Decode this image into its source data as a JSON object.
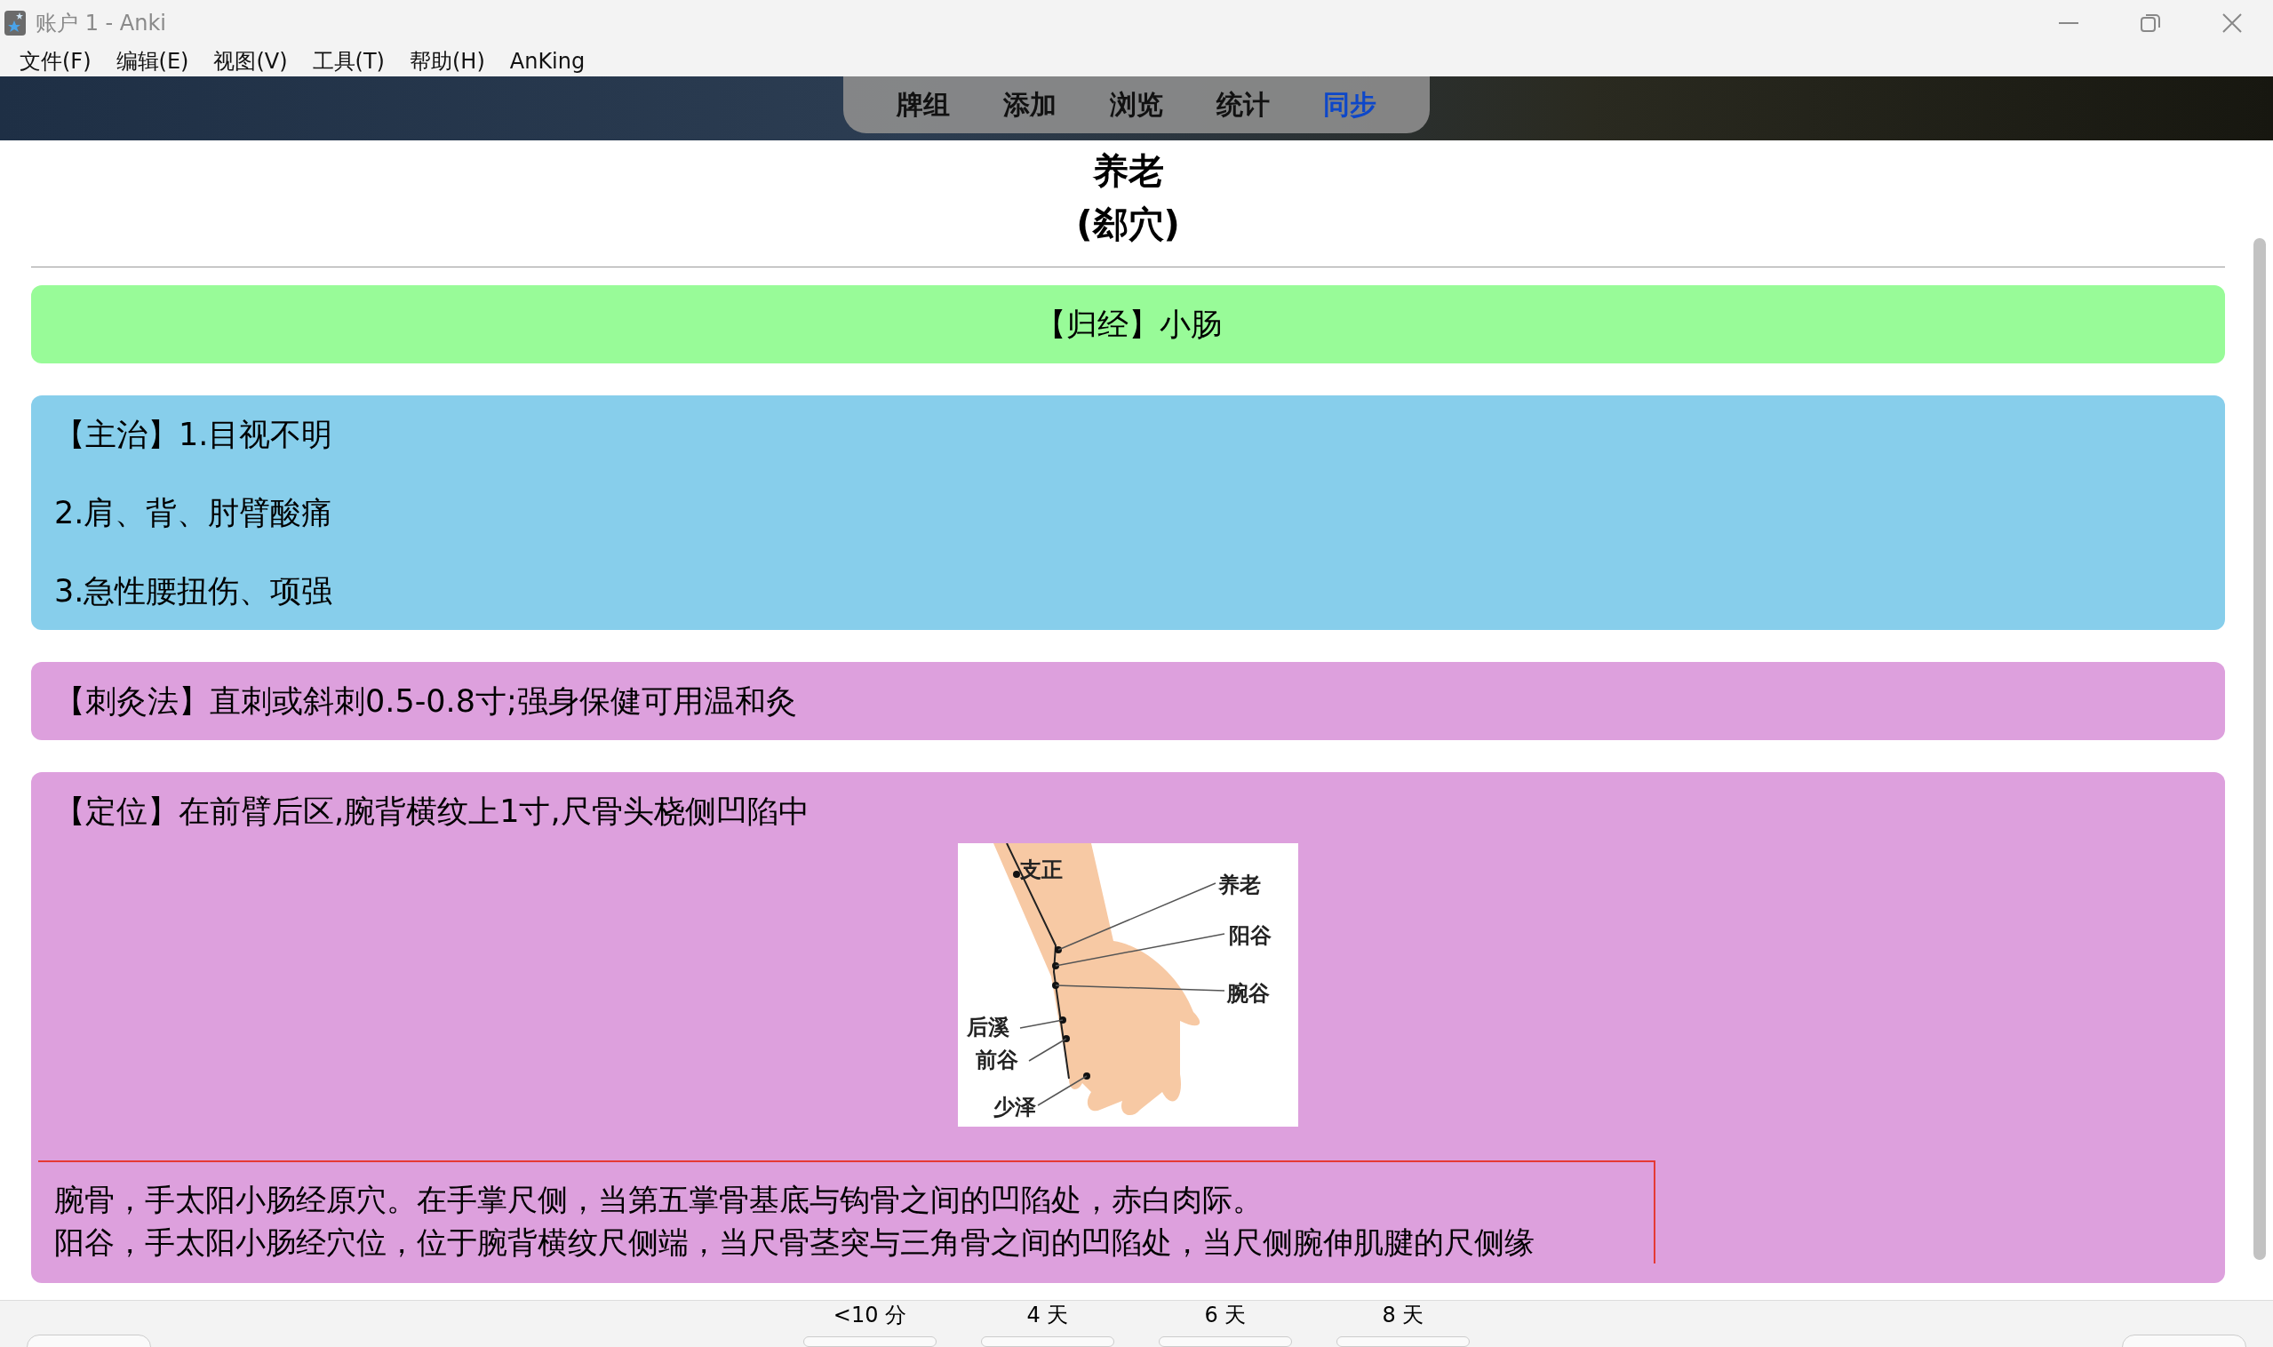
{
  "window": {
    "title": "账户 1 - Anki"
  },
  "menu": [
    "文件(F)",
    "编辑(E)",
    "视图(V)",
    "工具(T)",
    "帮助(H)",
    "AnKing"
  ],
  "toolbar": [
    {
      "label": "牌组",
      "highlighted": false
    },
    {
      "label": "添加",
      "highlighted": false
    },
    {
      "label": "浏览",
      "highlighted": false
    },
    {
      "label": "统计",
      "highlighted": false
    },
    {
      "label": "同步",
      "highlighted": true
    }
  ],
  "card": {
    "title": "养老",
    "subtitle": "(郄穴)",
    "sections": [
      {
        "kind": "centered",
        "color": "#98fb98",
        "lines": [
          "【归经】小肠"
        ]
      },
      {
        "kind": "list",
        "color": "#87ceeb",
        "lines": [
          "【主治】1.目视不明",
          "2.肩、背、肘臂酸痛",
          "3.急性腰扭伤、项强"
        ]
      },
      {
        "kind": "list",
        "color": "#dda0dd",
        "lines": [
          "【刺灸法】直刺或斜刺0.5-0.8寸;强身保健可用温和灸"
        ]
      },
      {
        "kind": "location",
        "color": "#dda0dd",
        "lines": [
          "【定位】在前臂后区,腕背横纹上1寸,尺骨头桡侧凹陷中"
        ],
        "figure_labels": [
          "支正",
          "养老",
          "阳谷",
          "腕谷",
          "后溪",
          "前谷",
          "少泽"
        ],
        "notes": [
          "腕骨，手太阳小肠经原穴。在手掌尺侧，当第五掌骨基底与钩骨之间的凹陷处，赤白肉际。",
          "阳谷，手太阳小肠经穴位，位于腕背横纹尺侧端，当尺骨茎突与三角骨之间的凹陷处，当尺侧腕伸肌腱的尺侧缘"
        ]
      }
    ]
  },
  "answer_buttons": [
    "<10 分",
    "4 天",
    "6 天",
    "8 天"
  ]
}
